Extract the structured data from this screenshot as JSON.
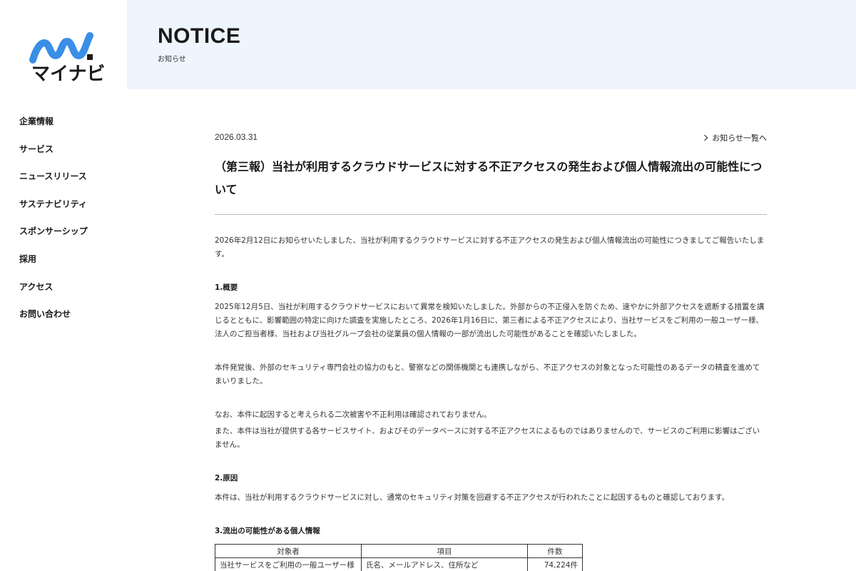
{
  "brand": {
    "logo_text": "マイナビ",
    "logo_colors": [
      "#3a8ee6",
      "#1a1a1a"
    ]
  },
  "sidebar": {
    "items": [
      {
        "label": "企業情報"
      },
      {
        "label": "サービス"
      },
      {
        "label": "ニュースリリース"
      },
      {
        "label": "サステナビリティ"
      },
      {
        "label": "スポンサーシップ"
      },
      {
        "label": "採用"
      },
      {
        "label": "アクセス"
      },
      {
        "label": "お問い合わせ"
      }
    ]
  },
  "header": {
    "title": "NOTICE",
    "subtitle": "お知らせ",
    "background": "#eef5fc"
  },
  "article": {
    "date": "2026.03.31",
    "back_link": "お知らせ一覧へ",
    "title": "（第三報）当社が利用するクラウドサービスに対する不正アクセスの発生および個人情報流出の可能性について",
    "intro": "2026年2月12日にお知らせいたしました、当社が利用するクラウドサービスに対する不正アクセスの発生および個人情報流出の可能性につきましてご報告いたします。",
    "sections": [
      {
        "heading": "1.概要",
        "paragraphs": [
          "2025年12月5日、当社が利用するクラウドサービスにおいて異常を検知いたしました。外部からの不正侵入を防ぐため、速やかに外部アクセスを遮断する措置を講じるとともに、影響範囲の特定に向けた調査を実施したところ、2026年1月16日に、第三者による不正アクセスにより、当社サービスをご利用の一般ユーザー様、法人のご担当者様、当社および当社グループ会社の従業員の個人情報の一部が流出した可能性があることを確認いたしました。",
          "本件発覚後、外部のセキュリティ専門会社の協力のもと、警察などの関係機関とも連携しながら、不正アクセスの対象となった可能性のあるデータの精査を進めてまいりました。",
          "なお、本件に起因すると考えられる二次被害や不正利用は確認されておりません。",
          "また、本件は当社が提供する各サービスサイト、およびそのデータベースに対する不正アクセスによるものではありませんので、サービスのご利用に影響はございません。"
        ]
      },
      {
        "heading": "2.原因",
        "paragraphs": [
          "本件は、当社が利用するクラウドサービスに対し、通常のセキュリティ対策を回避する不正アクセスが行われたことに起因するものと確認しております。"
        ]
      },
      {
        "heading": "3.流出の可能性がある個人情報"
      }
    ],
    "table": {
      "headers": [
        "対象者",
        "項目",
        "件数"
      ],
      "rows": [
        [
          "当社サービスをご利用の一般ユーザー様",
          "氏名、メールアドレス、住所など",
          "74,224件"
        ]
      ]
    }
  }
}
